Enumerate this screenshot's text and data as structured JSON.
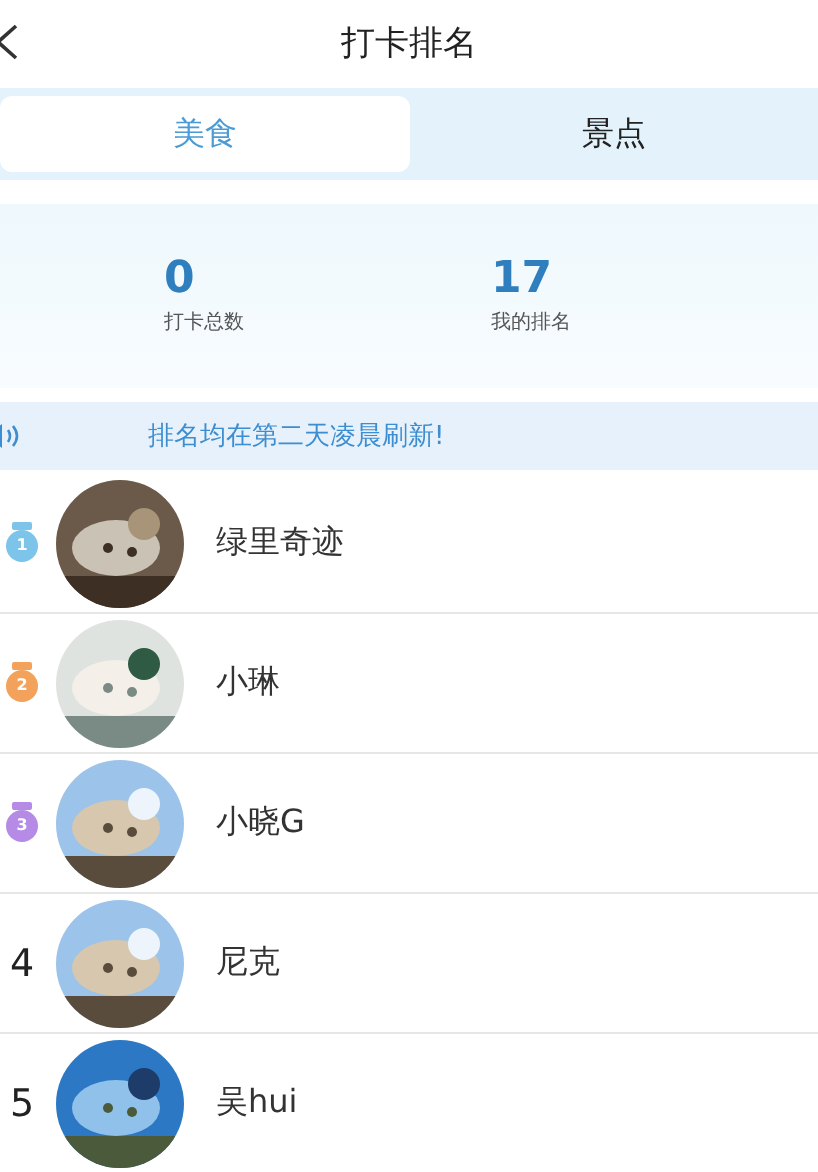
{
  "header": {
    "title": "打卡排名"
  },
  "tabs": [
    {
      "label": "美食",
      "selected": true
    },
    {
      "label": "景点",
      "selected": false
    }
  ],
  "stats": [
    {
      "value": "0",
      "label": "打卡总数"
    },
    {
      "value": "17",
      "label": "我的排名"
    }
  ],
  "notice": {
    "text": "排名均在第二天凌晨刷新!"
  },
  "ranking": [
    {
      "kind": "medal",
      "rank": "1",
      "color": "#7cc4ea",
      "name": "绿里奇迹"
    },
    {
      "kind": "medal",
      "rank": "2",
      "color": "#f2a25a",
      "name": "小琳"
    },
    {
      "kind": "medal",
      "rank": "3",
      "color": "#b58be6",
      "name": "小晓G"
    },
    {
      "kind": "plain",
      "rank": "4",
      "name": "尼克"
    },
    {
      "kind": "plain",
      "rank": "5",
      "name": "吴hui"
    }
  ]
}
